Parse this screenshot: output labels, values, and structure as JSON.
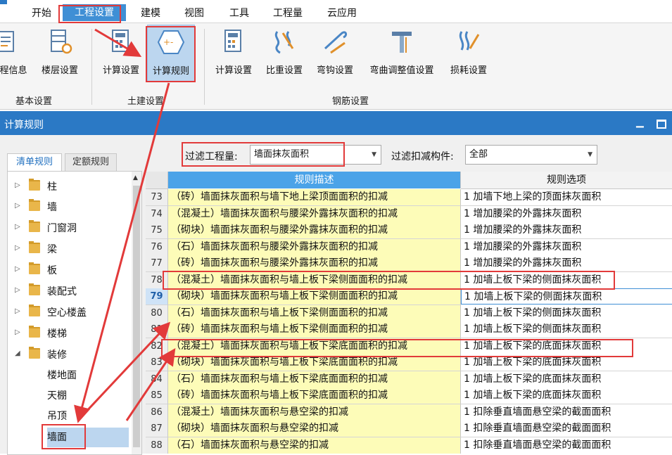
{
  "menu": {
    "items": [
      "开始",
      "工程设置",
      "建模",
      "视图",
      "工具",
      "工程量",
      "云应用"
    ]
  },
  "ribbon": {
    "groups": [
      {
        "label": "基本设置",
        "buttons": [
          "程信息",
          "楼层设置"
        ]
      },
      {
        "label": "土建设置",
        "buttons": [
          "计算设置",
          "计算规则"
        ]
      },
      {
        "label": "钢筋设置",
        "buttons": [
          "计算设置",
          "比重设置",
          "弯钩设置",
          "弯曲调整值设置",
          "损耗设置"
        ]
      }
    ]
  },
  "dialog": {
    "title": "计算规则",
    "min_symbol": "▁",
    "tabs": [
      "清单规则",
      "定额规则"
    ],
    "filter": {
      "quantity_label": "过滤工程量:",
      "quantity_value": "墙面抹灰面积",
      "component_label": "过滤扣减构件:",
      "component_value": "全部"
    },
    "tree": {
      "folders": [
        "柱",
        "墙",
        "门窗洞",
        "梁",
        "板",
        "装配式",
        "空心楼盖",
        "楼梯",
        "装修"
      ],
      "children": [
        "楼地面",
        "天棚",
        "吊顶",
        "墙面"
      ],
      "selected": "墙面"
    },
    "grid": {
      "headers": {
        "description": "规则描述",
        "option": "规则选项"
      },
      "rows": [
        {
          "no": "73",
          "desc": "（砖）墙面抹灰面积与墙下地上梁顶面面积的扣减",
          "opt": "1  加墙下地上梁的顶面抹灰面积"
        },
        {
          "no": "74",
          "desc": "（混凝土）墙面抹灰面积与腰梁外露抹灰面积的扣减",
          "opt": "1  增加腰梁的外露抹灰面积"
        },
        {
          "no": "75",
          "desc": "（砌块）墙面抹灰面积与腰梁外露抹灰面积的扣减",
          "opt": "1  增加腰梁的外露抹灰面积"
        },
        {
          "no": "76",
          "desc": "（石）墙面抹灰面积与腰梁外露抹灰面积的扣减",
          "opt": "1  增加腰梁的外露抹灰面积"
        },
        {
          "no": "77",
          "desc": "（砖）墙面抹灰面积与腰梁外露抹灰面积的扣减",
          "opt": "1  增加腰梁的外露抹灰面积"
        },
        {
          "no": "78",
          "desc": "（混凝土）墙面抹灰面积与墙上板下梁侧面面积的扣减",
          "opt": "1  加墙上板下梁的侧面抹灰面积"
        },
        {
          "no": "79",
          "desc": "（砌块）墙面抹灰面积与墙上板下梁侧面面积的扣减",
          "opt": "1  加墙上板下梁的侧面抹灰面积"
        },
        {
          "no": "80",
          "desc": "（石）墙面抹灰面积与墙上板下梁侧面面积的扣减",
          "opt": "1  加墙上板下梁的侧面抹灰面积"
        },
        {
          "no": "81",
          "desc": "（砖）墙面抹灰面积与墙上板下梁侧面面积的扣减",
          "opt": "1  加墙上板下梁的侧面抹灰面积"
        },
        {
          "no": "82",
          "desc": "（混凝土）墙面抹灰面积与墙上板下梁底面面积的扣减",
          "opt": "1  加墙上板下梁的底面抹灰面积"
        },
        {
          "no": "83",
          "desc": "（砌块）墙面抹灰面积与墙上板下梁底面面积的扣减",
          "opt": "1  加墙上板下梁的底面抹灰面积"
        },
        {
          "no": "84",
          "desc": "（石）墙面抹灰面积与墙上板下梁底面面积的扣减",
          "opt": "1  加墙上板下梁的底面抹灰面积"
        },
        {
          "no": "85",
          "desc": "（砖）墙面抹灰面积与墙上板下梁底面面积的扣减",
          "opt": "1  加墙上板下梁的底面抹灰面积"
        },
        {
          "no": "86",
          "desc": "（混凝土）墙面抹灰面积与悬空梁的扣减",
          "opt": "1  扣除垂直墙面悬空梁的截面面积"
        },
        {
          "no": "87",
          "desc": "（砌块）墙面抹灰面积与悬空梁的扣减",
          "opt": "1  扣除垂直墙面悬空梁的截面面积"
        },
        {
          "no": "88",
          "desc": "（石）墙面抹灰面积与悬空梁的扣减",
          "opt": "1  扣除垂直墙面悬空梁的截面面积"
        }
      ],
      "current_row": "79"
    }
  },
  "colors": {
    "accent": "#3f8fd5",
    "title_bar": "#2b79c5",
    "desc_bg": "#fdfcb8",
    "annotation": "#e23a3a"
  }
}
